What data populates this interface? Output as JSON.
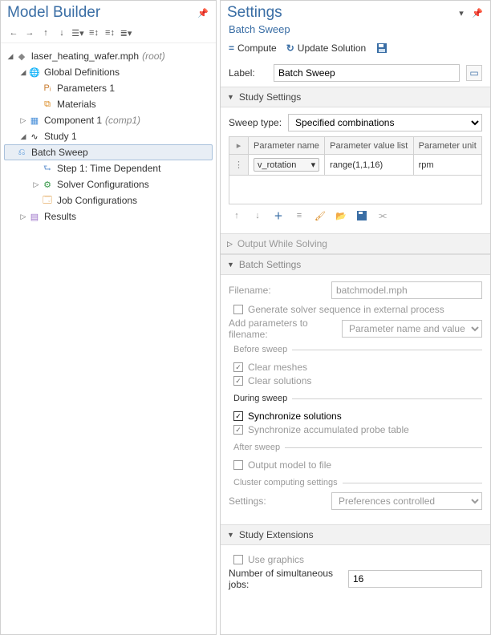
{
  "left": {
    "title": "Model Builder",
    "tree": [
      {
        "indent": 0,
        "arrow": "▢",
        "icon": "mph",
        "label": "laser_heating_wafer.mph",
        "suffix": "(root)",
        "sel": false
      },
      {
        "indent": 1,
        "arrow": "▢",
        "icon": "globe",
        "label": "Global Definitions",
        "suffix": "",
        "sel": false
      },
      {
        "indent": 2,
        "arrow": "",
        "icon": "pi",
        "label": "Parameters 1",
        "suffix": "",
        "sel": false
      },
      {
        "indent": 2,
        "arrow": "",
        "icon": "mat",
        "label": "Materials",
        "suffix": "",
        "sel": false
      },
      {
        "indent": 1,
        "arrow": "▷",
        "icon": "comp",
        "label": "Component 1",
        "suffix": "(comp1)",
        "sel": false
      },
      {
        "indent": 1,
        "arrow": "▢",
        "icon": "study",
        "label": "Study 1",
        "suffix": "",
        "sel": false
      },
      {
        "indent": 2,
        "arrow": "",
        "icon": "batch",
        "label": "Batch Sweep",
        "suffix": "",
        "sel": true
      },
      {
        "indent": 2,
        "arrow": "",
        "icon": "step",
        "label": "Step 1: Time Dependent",
        "suffix": "",
        "sel": false
      },
      {
        "indent": 2,
        "arrow": "▷",
        "icon": "solver",
        "label": "Solver Configurations",
        "suffix": "",
        "sel": false
      },
      {
        "indent": 2,
        "arrow": "",
        "icon": "job",
        "label": "Job Configurations",
        "suffix": "",
        "sel": false
      },
      {
        "indent": 1,
        "arrow": "▷",
        "icon": "results",
        "label": "Results",
        "suffix": "",
        "sel": false
      }
    ]
  },
  "right": {
    "title": "Settings",
    "subtitle": "Batch Sweep",
    "actions": {
      "compute": "Compute",
      "update": "Update Solution"
    },
    "label_caption": "Label:",
    "label_value": "Batch Sweep",
    "study_settings": {
      "header": "Study Settings",
      "sweep_type_label": "Sweep type:",
      "sweep_type_value": "Specified combinations",
      "columns": [
        "Parameter name",
        "Parameter value list",
        "Parameter unit"
      ],
      "row": {
        "name": "v_rotation",
        "values": "range(1,1,16)",
        "unit": "rpm"
      }
    },
    "output_while_solving": "Output While Solving",
    "batch_settings": {
      "header": "Batch Settings",
      "filename_label": "Filename:",
      "filename_value": "batchmodel.mph",
      "generate_solver": "Generate solver sequence in external process",
      "add_params_label": "Add parameters to filename:",
      "add_params_value": "Parameter name and value",
      "before_sweep": "Before sweep",
      "clear_meshes": "Clear meshes",
      "clear_solutions": "Clear solutions",
      "during_sweep": "During sweep",
      "sync_solutions": "Synchronize solutions",
      "sync_probe": "Synchronize accumulated probe table",
      "after_sweep": "After sweep",
      "output_model": "Output model to file",
      "cluster_header": "Cluster computing settings",
      "settings_label": "Settings:",
      "settings_value": "Preferences controlled"
    },
    "study_extensions": {
      "header": "Study Extensions",
      "use_graphics": "Use graphics",
      "num_jobs_label": "Number of simultaneous jobs:",
      "num_jobs_value": "16"
    }
  }
}
